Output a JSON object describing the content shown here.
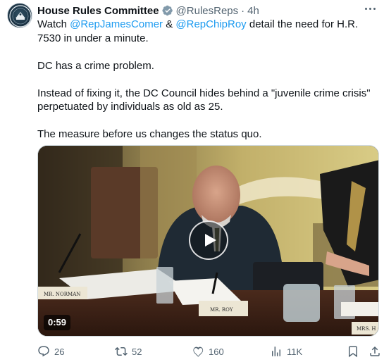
{
  "account": {
    "name": "House Rules Committee",
    "handle": "@RulesReps",
    "separator": "·",
    "time": "4h",
    "verified_color": "#829aab"
  },
  "tweet": {
    "p1_prefix": "Watch ",
    "mention1": "@RepJamesComer",
    "p1_amp": " & ",
    "mention2": "@RepChipRoy",
    "p1_suffix": " detail the need for H.R. 7530 in under a minute.",
    "p2": "DC has a crime problem.",
    "p3": "Instead of fixing it, the DC Council hides behind a \"juvenile crime crisis\" perpetuated by individuals as old as 25.",
    "p4": "The measure before us changes the status quo."
  },
  "video": {
    "duration": "0:59",
    "placards": {
      "left": "MR. NORMAN",
      "center": "MR. ROY",
      "right": "MRS. H"
    }
  },
  "actions": {
    "replies": "26",
    "reposts": "52",
    "likes": "160",
    "views": "11K"
  },
  "icons": [
    "more-icon",
    "verified-badge-icon",
    "play-icon",
    "reply-icon",
    "repost-icon",
    "like-icon",
    "views-icon",
    "bookmark-icon",
    "share-icon"
  ],
  "colors": {
    "link": "#1d9bf0",
    "secondary_text": "#536471",
    "primary_text": "#0f1419"
  }
}
